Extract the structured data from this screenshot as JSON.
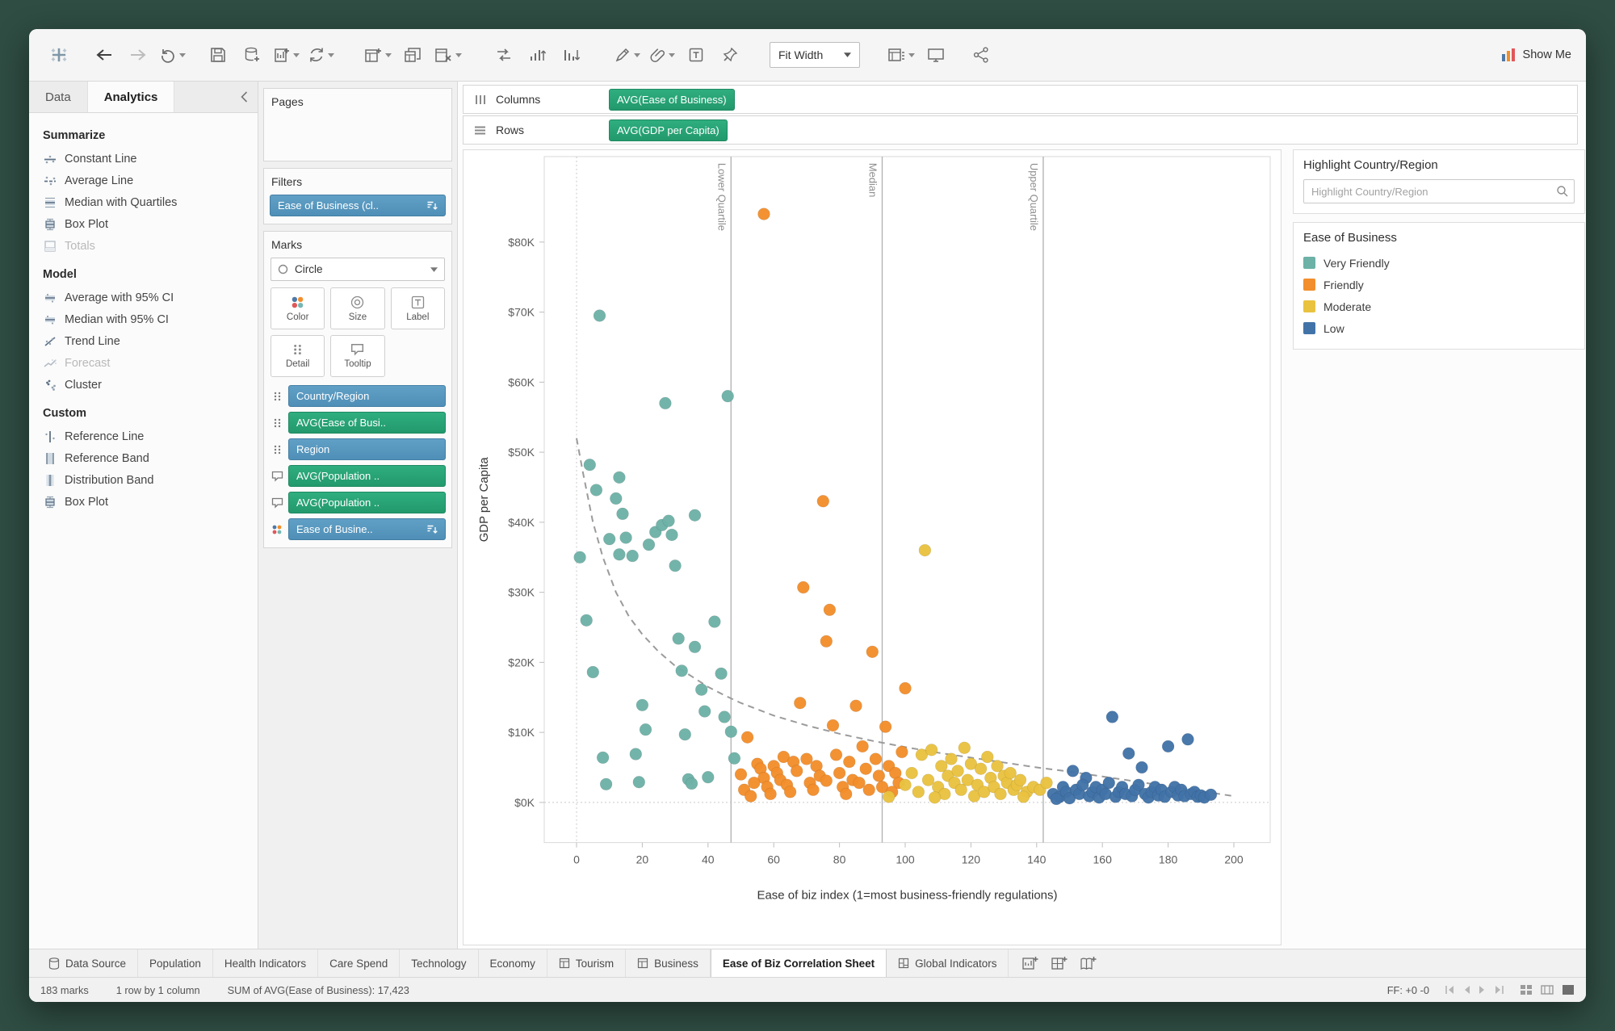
{
  "toolbar": {
    "fit_label": "Fit Width",
    "show_me_label": "Show Me"
  },
  "sidebar": {
    "tabs": [
      {
        "label": "Data",
        "active": false
      },
      {
        "label": "Analytics",
        "active": true
      }
    ],
    "sections": [
      {
        "title": "Summarize",
        "items": [
          {
            "label": "Constant Line",
            "icon": "constant-line"
          },
          {
            "label": "Average Line",
            "icon": "average-line"
          },
          {
            "label": "Median with Quartiles",
            "icon": "median-quartiles"
          },
          {
            "label": "Box Plot",
            "icon": "box-plot"
          },
          {
            "label": "Totals",
            "icon": "totals",
            "disabled": true
          }
        ]
      },
      {
        "title": "Model",
        "items": [
          {
            "label": "Average with 95% CI",
            "icon": "ci-band"
          },
          {
            "label": "Median with 95% CI",
            "icon": "ci-band"
          },
          {
            "label": "Trend Line",
            "icon": "trend-line"
          },
          {
            "label": "Forecast",
            "icon": "forecast",
            "disabled": true
          },
          {
            "label": "Cluster",
            "icon": "cluster"
          }
        ]
      },
      {
        "title": "Custom",
        "items": [
          {
            "label": "Reference Line",
            "icon": "reference-line"
          },
          {
            "label": "Reference Band",
            "icon": "reference-band"
          },
          {
            "label": "Distribution Band",
            "icon": "distribution-band"
          },
          {
            "label": "Box Plot",
            "icon": "box-plot"
          }
        ]
      }
    ]
  },
  "shelves": {
    "pages_label": "Pages",
    "filters_label": "Filters",
    "filter_pills": [
      {
        "label": "Ease of Business (cl..",
        "color": "blue",
        "right_icon": "sort"
      }
    ],
    "marks_label": "Marks",
    "mark_type": "Circle",
    "mark_buttons": [
      {
        "label": "Color",
        "icon": "color"
      },
      {
        "label": "Size",
        "icon": "size"
      },
      {
        "label": "Label",
        "icon": "label"
      },
      {
        "label": "Detail",
        "icon": "detail"
      },
      {
        "label": "Tooltip",
        "icon": "tooltip"
      }
    ],
    "mark_pills": [
      {
        "gutter": "detail",
        "label": "Country/Region",
        "color": "blue"
      },
      {
        "gutter": "detail",
        "label": "AVG(Ease of Busi..",
        "color": "green"
      },
      {
        "gutter": "detail",
        "label": "Region",
        "color": "blue"
      },
      {
        "gutter": "tooltip",
        "label": "AVG(Population ..",
        "color": "green"
      },
      {
        "gutter": "tooltip",
        "label": "AVG(Population ..",
        "color": "green"
      },
      {
        "gutter": "color",
        "label": "Ease of Busine..",
        "color": "blue",
        "right_icon": "sort"
      }
    ],
    "columns_label": "Columns",
    "rows_label": "Rows",
    "columns_pills": [
      {
        "label": "AVG(Ease of Business)",
        "color": "green"
      }
    ],
    "rows_pills": [
      {
        "label": "AVG(GDP per Capita)",
        "color": "green"
      }
    ]
  },
  "right_panel": {
    "highlight_title": "Highlight Country/Region",
    "highlight_placeholder": "Highlight Country/Region",
    "legend_title": "Ease of Business",
    "legend_items": [
      {
        "label": "Very Friendly",
        "color": "#6db1a7"
      },
      {
        "label": "Friendly",
        "color": "#f28e2b"
      },
      {
        "label": "Moderate",
        "color": "#e9c23f"
      },
      {
        "label": "Low",
        "color": "#4273a8"
      }
    ]
  },
  "chart_data": {
    "type": "scatter",
    "xlabel": "Ease of biz index (1=most business-friendly regulations)",
    "ylabel": "GDP per Capita",
    "x_ticks": [
      0,
      20,
      40,
      60,
      80,
      100,
      120,
      140,
      160,
      180,
      200
    ],
    "y_ticks": [
      {
        "v": 0,
        "label": "$0K"
      },
      {
        "v": 10,
        "label": "$10K"
      },
      {
        "v": 20,
        "label": "$20K"
      },
      {
        "v": 30,
        "label": "$30K"
      },
      {
        "v": 40,
        "label": "$40K"
      },
      {
        "v": 50,
        "label": "$50K"
      },
      {
        "v": 60,
        "label": "$60K"
      },
      {
        "v": 70,
        "label": "$70K"
      },
      {
        "v": 80,
        "label": "$80K"
      }
    ],
    "xlim": [
      -10,
      210
    ],
    "ylim": [
      0,
      88
    ],
    "y_units": "thousands of USD",
    "grid": false,
    "legend_position": "right",
    "reference_lines": [
      {
        "x": 47,
        "label": "Lower Quartile"
      },
      {
        "x": 93,
        "label": "Median"
      },
      {
        "x": 142,
        "label": "Upper Quartile"
      }
    ],
    "trend_line": {
      "style": "dashed",
      "points": [
        [
          0,
          52
        ],
        [
          2,
          47
        ],
        [
          5,
          40
        ],
        [
          8,
          35
        ],
        [
          12,
          30
        ],
        [
          16,
          26.5
        ],
        [
          20,
          24
        ],
        [
          25,
          21.5
        ],
        [
          30,
          19.5
        ],
        [
          35,
          18
        ],
        [
          40,
          16.5
        ],
        [
          45,
          15.3
        ],
        [
          50,
          14.2
        ],
        [
          60,
          12.4
        ],
        [
          70,
          11
        ],
        [
          80,
          9.8
        ],
        [
          90,
          8.8
        ],
        [
          100,
          7.9
        ],
        [
          110,
          7.1
        ],
        [
          120,
          6.4
        ],
        [
          130,
          5.7
        ],
        [
          140,
          5.0
        ],
        [
          150,
          4.4
        ],
        [
          160,
          3.7
        ],
        [
          170,
          3.0
        ],
        [
          180,
          2.3
        ],
        [
          190,
          1.6
        ],
        [
          200,
          0.9
        ]
      ]
    },
    "series": [
      {
        "name": "Very Friendly",
        "color": "#6db1a7",
        "points": [
          [
            1,
            35
          ],
          [
            3,
            26
          ],
          [
            4,
            48.2
          ],
          [
            6,
            44.6
          ],
          [
            7,
            69.5
          ],
          [
            5,
            18.6
          ],
          [
            8,
            6.4
          ],
          [
            9,
            2.6
          ],
          [
            10,
            37.6
          ],
          [
            12,
            43.4
          ],
          [
            13,
            46.4
          ],
          [
            14,
            41.2
          ],
          [
            15,
            37.8
          ],
          [
            13,
            35.4
          ],
          [
            17,
            35.2
          ],
          [
            18,
            6.9
          ],
          [
            19,
            2.9
          ],
          [
            20,
            13.9
          ],
          [
            21,
            10.4
          ],
          [
            22,
            36.8
          ],
          [
            24,
            38.6
          ],
          [
            26,
            39.6
          ],
          [
            27,
            57
          ],
          [
            28,
            40.2
          ],
          [
            29,
            38.2
          ],
          [
            30,
            33.8
          ],
          [
            31,
            23.4
          ],
          [
            32,
            18.8
          ],
          [
            33,
            9.7
          ],
          [
            34,
            3.3
          ],
          [
            35,
            2.7
          ],
          [
            36,
            22.2
          ],
          [
            36,
            41
          ],
          [
            38,
            16.1
          ],
          [
            39,
            13
          ],
          [
            40,
            3.6
          ],
          [
            42,
            25.8
          ],
          [
            44,
            18.4
          ],
          [
            45,
            12.2
          ],
          [
            46,
            58
          ],
          [
            47,
            10.1
          ],
          [
            48,
            6.3
          ]
        ]
      },
      {
        "name": "Friendly",
        "color": "#f28e2b",
        "points": [
          [
            57,
            84
          ],
          [
            75,
            43
          ],
          [
            69,
            30.7
          ],
          [
            77,
            27.5
          ],
          [
            76,
            23
          ],
          [
            90,
            21.5
          ],
          [
            100,
            16.3
          ],
          [
            68,
            14.2
          ],
          [
            85,
            13.8
          ],
          [
            78,
            11
          ],
          [
            94,
            10.8
          ],
          [
            52,
            9.3
          ],
          [
            87,
            8
          ],
          [
            99,
            7.2
          ],
          [
            79,
            6.8
          ],
          [
            63,
            6.5
          ],
          [
            91,
            6.2
          ],
          [
            70,
            6.2
          ],
          [
            66,
            5.8
          ],
          [
            83,
            5.8
          ],
          [
            55,
            5.5
          ],
          [
            60,
            5.2
          ],
          [
            73,
            5.2
          ],
          [
            95,
            5.2
          ],
          [
            56,
            4.8
          ],
          [
            88,
            4.8
          ],
          [
            67,
            4.5
          ],
          [
            61,
            4.2
          ],
          [
            80,
            4.2
          ],
          [
            97,
            4.2
          ],
          [
            50,
            4
          ],
          [
            74,
            3.8
          ],
          [
            92,
            3.8
          ],
          [
            57,
            3.5
          ],
          [
            84,
            3.2
          ],
          [
            62,
            3.2
          ],
          [
            76,
            3.1
          ],
          [
            54,
            2.8
          ],
          [
            71,
            2.8
          ],
          [
            86,
            2.8
          ],
          [
            98,
            2.8
          ],
          [
            64,
            2.5
          ],
          [
            58,
            2.2
          ],
          [
            81,
            2.2
          ],
          [
            93,
            2.2
          ],
          [
            51,
            1.8
          ],
          [
            72,
            1.8
          ],
          [
            89,
            1.8
          ],
          [
            65,
            1.5
          ],
          [
            96,
            1.5
          ],
          [
            59,
            1.2
          ],
          [
            82,
            1.2
          ],
          [
            53,
            0.9
          ]
        ]
      },
      {
        "name": "Moderate",
        "color": "#e9c23f",
        "points": [
          [
            106,
            36
          ],
          [
            95,
            0.8
          ],
          [
            100,
            2.5
          ],
          [
            102,
            4.2
          ],
          [
            104,
            1.5
          ],
          [
            105,
            6.8
          ],
          [
            107,
            3.2
          ],
          [
            108,
            7.5
          ],
          [
            110,
            2.2
          ],
          [
            111,
            5.2
          ],
          [
            112,
            1.2
          ],
          [
            113,
            3.8
          ],
          [
            114,
            6.2
          ],
          [
            115,
            2.8
          ],
          [
            116,
            4.5
          ],
          [
            117,
            1.8
          ],
          [
            118,
            7.8
          ],
          [
            119,
            3.2
          ],
          [
            120,
            5.5
          ],
          [
            121,
            0.9
          ],
          [
            122,
            2.5
          ],
          [
            123,
            4.8
          ],
          [
            124,
            1.5
          ],
          [
            125,
            6.5
          ],
          [
            126,
            3.5
          ],
          [
            127,
            2.2
          ],
          [
            128,
            5.2
          ],
          [
            129,
            1.2
          ],
          [
            130,
            3.8
          ],
          [
            131,
            2.8
          ],
          [
            132,
            4.2
          ],
          [
            133,
            1.8
          ],
          [
            134,
            2.5
          ],
          [
            135,
            3.2
          ],
          [
            137,
            1.5
          ],
          [
            139,
            2.2
          ],
          [
            141,
            1.8
          ],
          [
            143,
            2.8
          ],
          [
            109,
            0.7
          ],
          [
            136,
            0.8
          ]
        ]
      },
      {
        "name": "Low",
        "color": "#4273a8",
        "points": [
          [
            163,
            12.2
          ],
          [
            186,
            9
          ],
          [
            180,
            8
          ],
          [
            168,
            7
          ],
          [
            172,
            5
          ],
          [
            151,
            4.5
          ],
          [
            155,
            3.5
          ],
          [
            145,
            1.2
          ],
          [
            147,
            0.8
          ],
          [
            148,
            2.2
          ],
          [
            149,
            1.5
          ],
          [
            150,
            0.6
          ],
          [
            152,
            1.8
          ],
          [
            153,
            1.2
          ],
          [
            154,
            2.5
          ],
          [
            156,
            0.9
          ],
          [
            157,
            1.5
          ],
          [
            158,
            2.2
          ],
          [
            159,
            0.7
          ],
          [
            160,
            1.8
          ],
          [
            161,
            1.2
          ],
          [
            162,
            2.8
          ],
          [
            164,
            0.8
          ],
          [
            165,
            1.5
          ],
          [
            166,
            2.2
          ],
          [
            167,
            1.2
          ],
          [
            169,
            0.9
          ],
          [
            170,
            1.8
          ],
          [
            171,
            2.5
          ],
          [
            173,
            1.2
          ],
          [
            174,
            0.7
          ],
          [
            175,
            1.5
          ],
          [
            176,
            2.2
          ],
          [
            177,
            1
          ],
          [
            178,
            1.8
          ],
          [
            179,
            0.8
          ],
          [
            181,
            1.5
          ],
          [
            182,
            2.2
          ],
          [
            183,
            1
          ],
          [
            184,
            1.8
          ],
          [
            185,
            0.9
          ],
          [
            187,
            1.2
          ],
          [
            188,
            1.5
          ],
          [
            189,
            0.8
          ],
          [
            190,
            1
          ],
          [
            191,
            0.7
          ],
          [
            193,
            1.1
          ],
          [
            146,
            0.5
          ]
        ]
      }
    ]
  },
  "sheet_tabs": {
    "tabs": [
      {
        "label": "Data Source",
        "icon": "datasource"
      },
      {
        "label": "Population"
      },
      {
        "label": "Health Indicators"
      },
      {
        "label": "Care Spend"
      },
      {
        "label": "Technology"
      },
      {
        "label": "Economy"
      },
      {
        "label": "Tourism",
        "icon": "sheet"
      },
      {
        "label": "Business",
        "icon": "sheet"
      },
      {
        "label": "Ease of Biz Correlation Sheet",
        "active": true
      },
      {
        "label": "Global Indicators",
        "icon": "dashboard"
      }
    ]
  },
  "status_bar": {
    "marks": "183 marks",
    "layout": "1 row by 1 column",
    "aggregate": "SUM of AVG(Ease of Business): 17,423",
    "ff": "FF: +0 -0"
  }
}
